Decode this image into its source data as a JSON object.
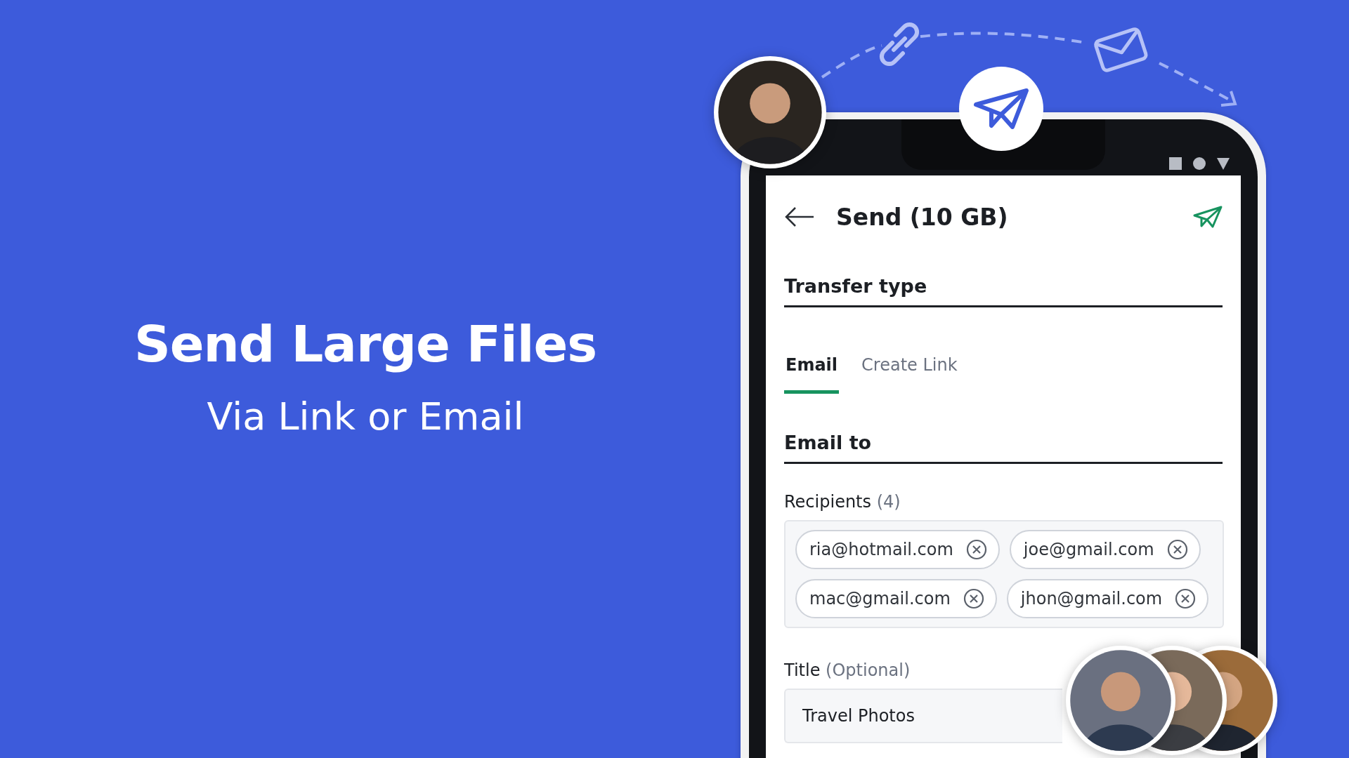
{
  "hero": {
    "title": "Send Large Files",
    "subtitle": "Via Link or Email"
  },
  "screen": {
    "title": "Send (10 GB)",
    "transfer_type": {
      "heading": "Transfer type",
      "tabs": [
        {
          "label": "Email",
          "selected": true
        },
        {
          "label": "Create Link",
          "selected": false
        }
      ]
    },
    "email_to": {
      "heading": "Email to",
      "recipients_label": "Recipients",
      "recipients_count": "(4)",
      "recipients": [
        {
          "address": "ria@hotmail.com"
        },
        {
          "address": "joe@gmail.com"
        },
        {
          "address": "mac@gmail.com"
        },
        {
          "address": "jhon@gmail.com"
        }
      ]
    },
    "title_field": {
      "label": "Title",
      "hint": "(Optional)",
      "value": "Travel Photos"
    }
  }
}
